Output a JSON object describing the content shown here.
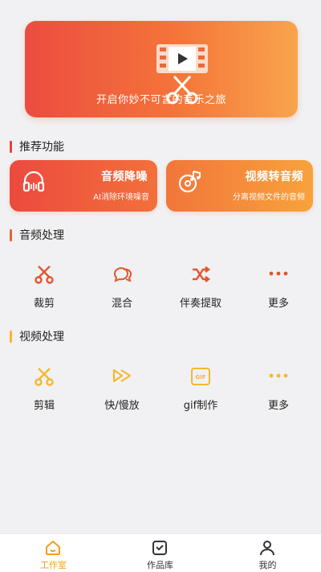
{
  "banner": {
    "text": "开启你妙不可言的音乐之旅"
  },
  "recommended": {
    "title": "推荐功能",
    "cards": [
      {
        "title": "音频降噪",
        "subtitle": "AI消除环境噪音",
        "icon": "headphones-icon"
      },
      {
        "title": "视频转音频",
        "subtitle": "分离视频文件的音频",
        "icon": "music-disc-icon"
      }
    ]
  },
  "audio": {
    "title": "音频处理",
    "accent": "#e8643a",
    "items": [
      {
        "label": "裁剪",
        "icon": "scissors-icon"
      },
      {
        "label": "混合",
        "icon": "chat-bubbles-icon"
      },
      {
        "label": "伴奏提取",
        "icon": "shuffle-icon"
      },
      {
        "label": "更多",
        "icon": "more-dots-icon"
      }
    ]
  },
  "video": {
    "title": "视频处理",
    "accent": "#f5b82e",
    "items": [
      {
        "label": "剪辑",
        "icon": "scissors-icon"
      },
      {
        "label": "快/慢放",
        "icon": "fast-forward-icon"
      },
      {
        "label": "gif制作",
        "icon": "gif-icon"
      },
      {
        "label": "更多",
        "icon": "more-dots-icon"
      }
    ]
  },
  "tabbar": {
    "active_color": "#f0a020",
    "items": [
      {
        "label": "工作室",
        "icon": "home-icon",
        "active": true
      },
      {
        "label": "作品库",
        "icon": "gallery-icon",
        "active": false
      },
      {
        "label": "我的",
        "icon": "person-icon",
        "active": false
      }
    ]
  }
}
